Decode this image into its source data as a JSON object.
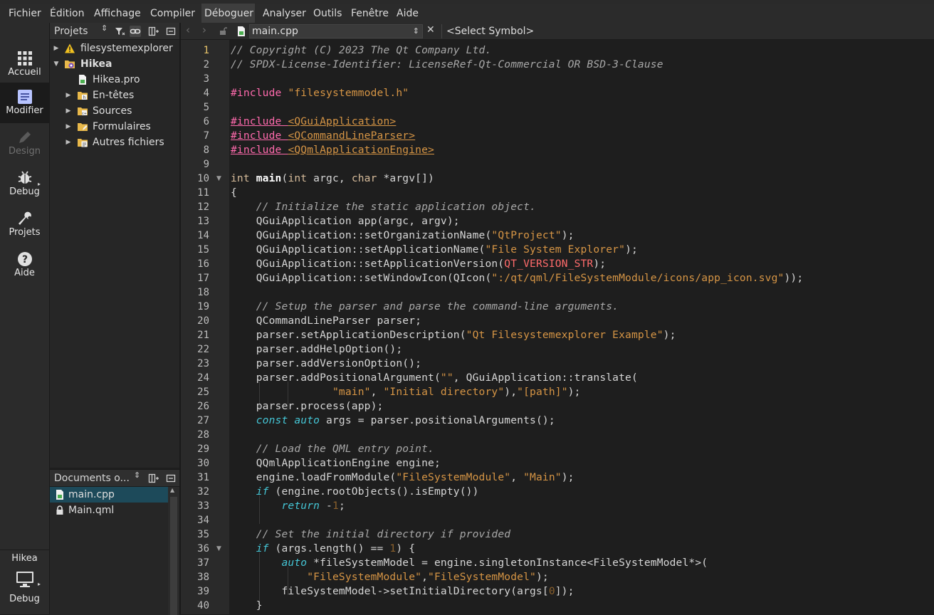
{
  "menu": [
    "Fichier",
    "Édition",
    "Affichage",
    "Compiler",
    "Déboguer",
    "Analyser",
    "Outils",
    "Fenêtre",
    "Aide"
  ],
  "modes": [
    {
      "label": "Accueil",
      "icon": "grid-icon"
    },
    {
      "label": "Modifier",
      "icon": "edit-icon"
    },
    {
      "label": "Design",
      "icon": "pen-icon"
    },
    {
      "label": "Debug",
      "icon": "bug-icon"
    },
    {
      "label": "Projets",
      "icon": "wrench-icon"
    },
    {
      "label": "Aide",
      "icon": "help-icon"
    }
  ],
  "kit": {
    "project": "Hikea",
    "config": "Debug"
  },
  "projects_pane": {
    "title": "Projets",
    "tree": [
      {
        "label": "filesystemexplorer",
        "icon": "warning-icon"
      },
      {
        "label": "Hikea",
        "icon": "project-folder-icon"
      },
      {
        "label": "Hikea.pro",
        "icon": "pro-file-icon"
      },
      {
        "label": "En-têtes",
        "icon": "headers-folder-icon"
      },
      {
        "label": "Sources",
        "icon": "sources-folder-icon"
      },
      {
        "label": "Formulaires",
        "icon": "forms-folder-icon"
      },
      {
        "label": "Autres fichiers",
        "icon": "other-files-folder-icon"
      }
    ]
  },
  "docs_pane": {
    "title": "Documents o...",
    "files": [
      "main.cpp",
      "Main.qml"
    ]
  },
  "editor": {
    "file": "main.cpp",
    "symbol": "<Select Symbol>",
    "current_line": 1,
    "line_numbers": [
      "1",
      "2",
      "3",
      "4",
      "5",
      "6",
      "7",
      "8",
      "9",
      "10",
      "11",
      "12",
      "13",
      "14",
      "15",
      "16",
      "17",
      "18",
      "19",
      "20",
      "21",
      "22",
      "23",
      "24",
      "25",
      "26",
      "27",
      "28",
      "29",
      "30",
      "31",
      "32",
      "33",
      "34",
      "35",
      "36",
      "37",
      "38",
      "39",
      "40"
    ],
    "code": [
      "// Copyright (C) 2023 The Qt Company Ltd.",
      "// SPDX-License-Identifier: LicenseRef-Qt-Commercial OR BSD-3-Clause",
      "",
      "#include \"filesystemmodel.h\"",
      "",
      "#include <QGuiApplication>",
      "#include <QCommandLineParser>",
      "#include <QQmlApplicationEngine>",
      "",
      "int main(int argc, char *argv[])",
      "{",
      "    // Initialize the static application object.",
      "    QGuiApplication app(argc, argv);",
      "    QGuiApplication::setOrganizationName(\"QtProject\");",
      "    QGuiApplication::setApplicationName(\"File System Explorer\");",
      "    QGuiApplication::setApplicationVersion(QT_VERSION_STR);",
      "    QGuiApplication::setWindowIcon(QIcon(\":/qt/qml/FileSystemModule/icons/app_icon.svg\"));",
      "",
      "    // Setup the parser and parse the command-line arguments.",
      "    QCommandLineParser parser;",
      "    parser.setApplicationDescription(\"Qt Filesystemexplorer Example\");",
      "    parser.addHelpOption();",
      "    parser.addVersionOption();",
      "    parser.addPositionalArgument(\"\", QGuiApplication::translate(",
      "                \"main\", \"Initial directory\"),\"[path]\");",
      "    parser.process(app);",
      "    const auto args = parser.positionalArguments();",
      "",
      "    // Load the QML entry point.",
      "    QQmlApplicationEngine engine;",
      "    engine.loadFromModule(\"FileSystemModule\", \"Main\");",
      "    if (engine.rootObjects().isEmpty())",
      "        return -1;",
      "",
      "    // Set the initial directory if provided",
      "    if (args.length() == 1) {",
      "        auto *fileSystemModel = engine.singletonInstance<FileSystemModel*>(",
      "            \"FileSystemModule\",\"FileSystemModel\");",
      "        fileSystemModel->setInitialDirectory(args[0]);",
      "    }"
    ]
  }
}
